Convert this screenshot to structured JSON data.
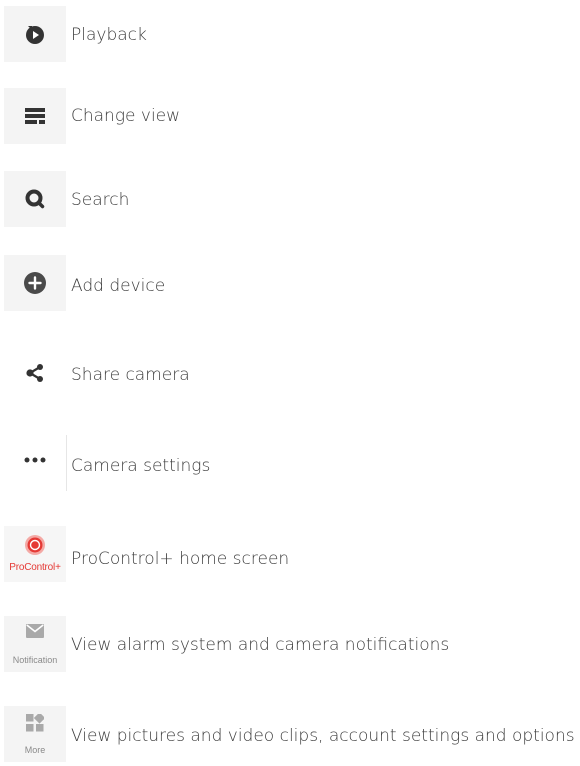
{
  "menu": {
    "items": [
      {
        "id": "playback",
        "icon": "playback-icon",
        "label": "Playback"
      },
      {
        "id": "change-view",
        "icon": "grid-view-icon",
        "label": "Change view"
      },
      {
        "id": "search",
        "icon": "search-icon",
        "label": "Search"
      },
      {
        "id": "add-device",
        "icon": "plus-circle-icon",
        "label": "Add device"
      },
      {
        "id": "share-camera",
        "icon": "share-icon",
        "label": "Share camera"
      },
      {
        "id": "camera-settings",
        "icon": "more-dots-icon",
        "label": "Camera settings"
      },
      {
        "id": "procontrol-home",
        "icon": "procontrol-logo-icon",
        "caption": "ProControl+",
        "label": "ProControl+ home screen"
      },
      {
        "id": "notifications",
        "icon": "envelope-icon",
        "caption": "Notification",
        "label": "View alarm system and camera notifications"
      },
      {
        "id": "more",
        "icon": "apps-grid-icon",
        "caption": "More",
        "label": "View pictures and video clips, account settings and options"
      }
    ]
  },
  "colors": {
    "icon_dark": "#333333",
    "tile_bg": "#f4f4f4",
    "brand_red": "#e53935",
    "caption_gray": "#8a8a8a",
    "text": "#3d3d3d"
  }
}
